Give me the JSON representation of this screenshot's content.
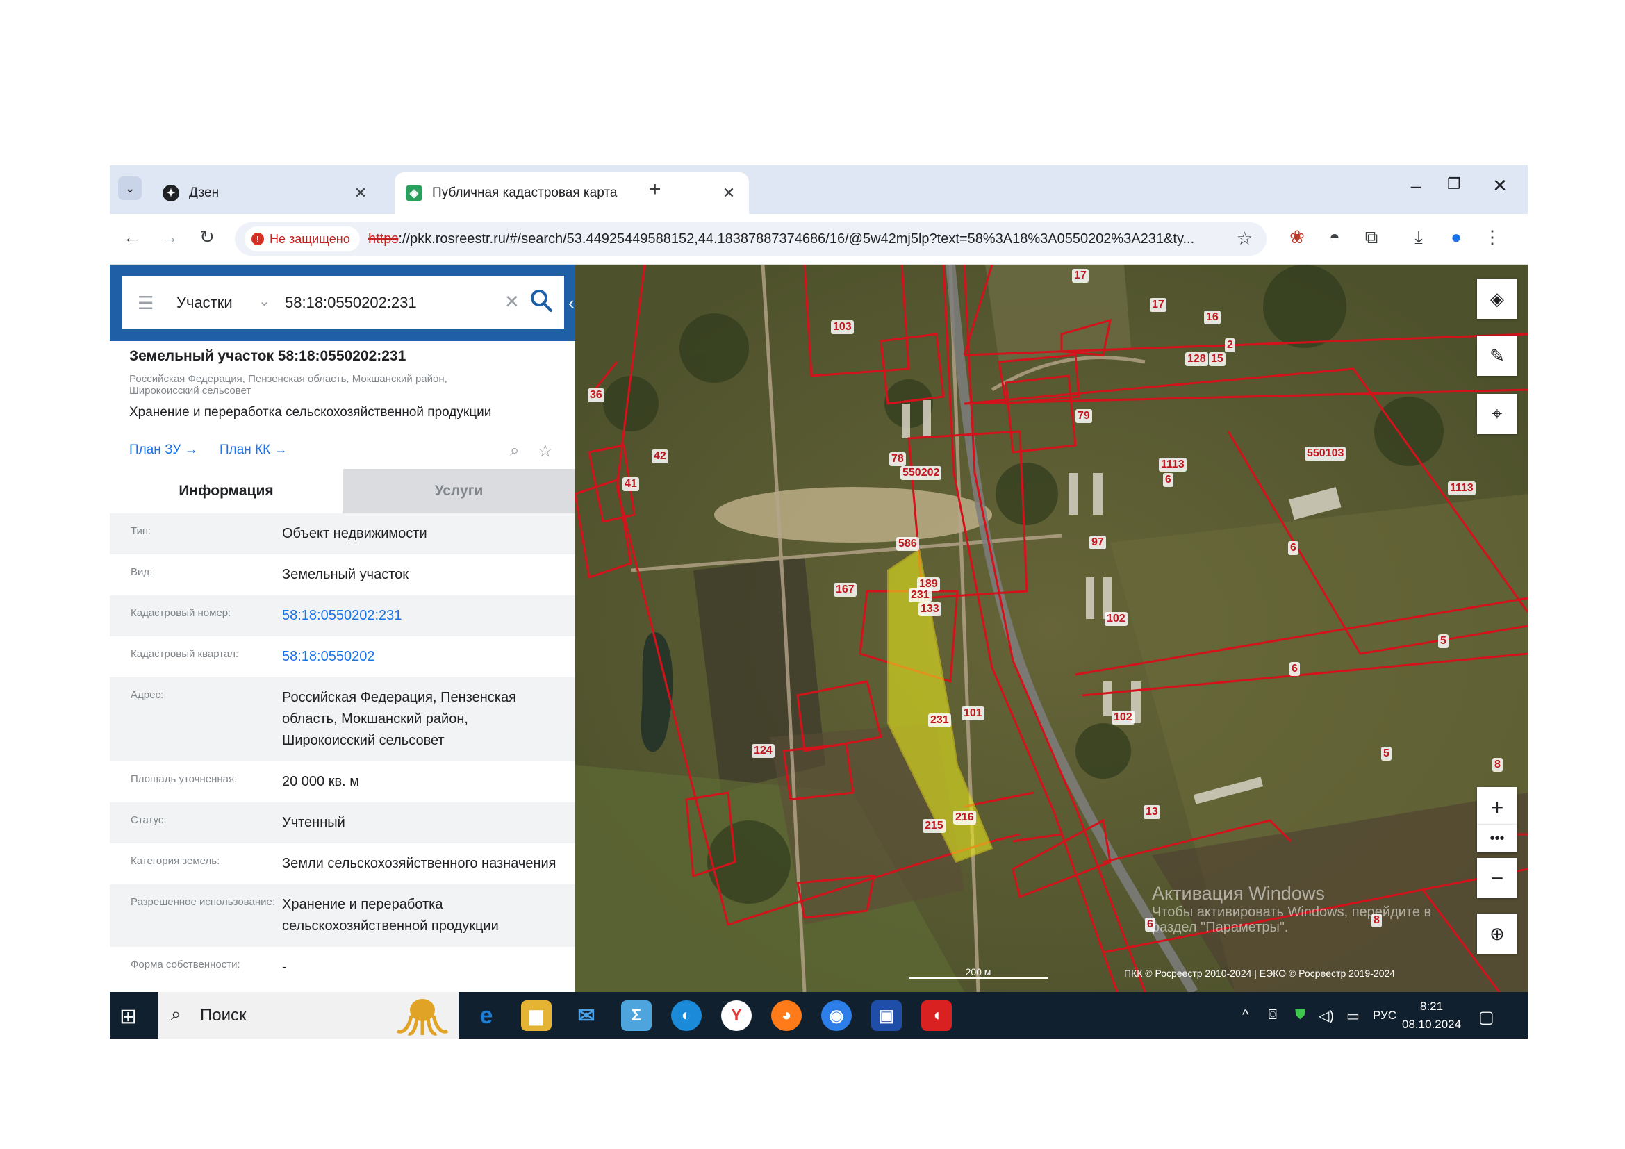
{
  "browser": {
    "tabs": [
      {
        "title": "Дзен",
        "active": false,
        "icon": "dzen-icon"
      },
      {
        "title": "Публичная кадастровая карта",
        "active": true,
        "icon": "pkk-icon"
      }
    ],
    "security_label": "Не защищено",
    "url_scheme": "https",
    "url_rest": "://pkk.rosreestr.ru/#/search/53.44925449588152,44.18387887374686/16/@5w42mj5lp?text=58%3A18%3A0550202%3A231&ty..."
  },
  "search": {
    "layer": "Участки",
    "query": "58:18:0550202:231"
  },
  "object": {
    "title": "Земельный участок 58:18:0550202:231",
    "address_short": "Российская Федерация, Пензенская область, Мокшанский район, Широкоисский сельсовет",
    "use": "Хранение и переработка сельскохозяйственной продукции",
    "plan_zu": "План ЗУ →",
    "plan_kk": "План КК →"
  },
  "info_tabs": {
    "info": "Информация",
    "services": "Услуги"
  },
  "attributes": [
    {
      "label": "Тип:",
      "value": "Объект недвижимости",
      "link": false
    },
    {
      "label": "Вид:",
      "value": "Земельный участок",
      "link": false
    },
    {
      "label": "Кадастровый номер:",
      "value": "58:18:0550202:231",
      "link": true
    },
    {
      "label": "Кадастровый квартал:",
      "value": "58:18:0550202",
      "link": true
    },
    {
      "label": "Адрес:",
      "value": "Российская Федерация, Пензенская область, Мокшанский район, Широкоисский сельсовет",
      "link": false
    },
    {
      "label": "Площадь уточненная:",
      "value": "20 000 кв. м",
      "link": false
    },
    {
      "label": "Статус:",
      "value": "Учтенный",
      "link": false
    },
    {
      "label": "Категория земель:",
      "value": "Земли сельскохозяйственного назначения",
      "link": false
    },
    {
      "label": "Разрешенное использование:",
      "value": "Хранение и переработка сельскохозяйственной продукции",
      "link": false
    },
    {
      "label": "Форма собственности:",
      "value": "-",
      "link": false
    }
  ],
  "map": {
    "parcel_labels": [
      "17",
      "17",
      "16",
      "2",
      "128",
      "15",
      "103",
      "36",
      "79",
      "78",
      "550202",
      "1113",
      "6",
      "550103",
      "1113",
      "42",
      "41",
      "97",
      "586",
      "167",
      "189",
      "133",
      "231",
      "102",
      "6",
      "5",
      "6",
      "231",
      "101",
      "102",
      "124",
      "13",
      "5",
      "215",
      "216",
      "8",
      "6",
      "8"
    ],
    "scale": "200 м",
    "attribution": "ПКК © Росреестр 2010-2024 | ЕЭКО © Росреестр 2019-2024",
    "activation_title": "Активация Windows",
    "activation_text": "Чтобы активировать Windows, перейдите в раздел \"Параметры\"."
  },
  "taskbar": {
    "search": "Поиск",
    "language": "РУС",
    "time": "8:21",
    "date": "08.10.2024"
  },
  "colors": {
    "parcel_border": "#d4121b",
    "selected_parcel": "#e8e81e",
    "panel_header": "#1e5fa6",
    "link": "#1a73e8"
  }
}
